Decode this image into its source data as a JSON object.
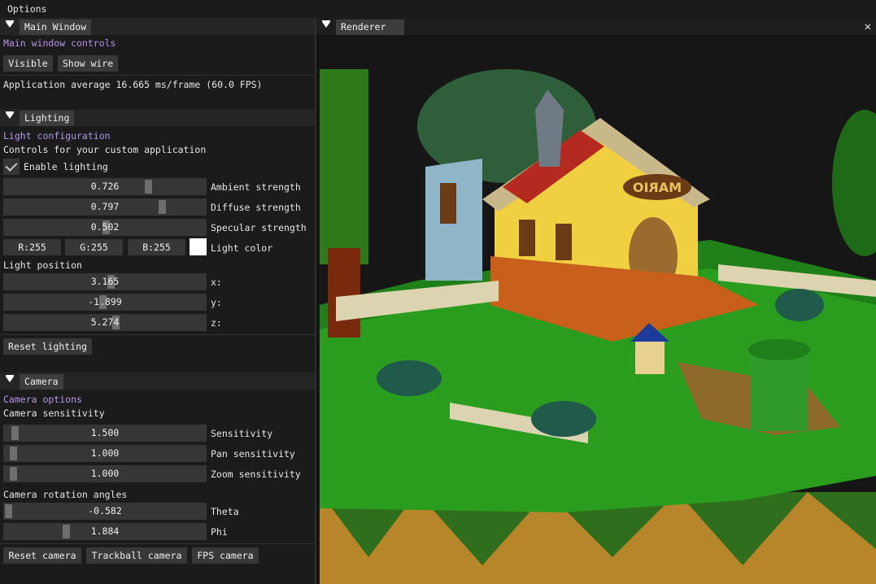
{
  "menubar": {
    "title": "Options"
  },
  "main_window": {
    "tab_label": "Main Window",
    "heading": "Main window controls",
    "visible_button": "Visible",
    "show_wire_button": "Show wire",
    "fps_text": "Application average 16.665 ms/frame (60.0 FPS)"
  },
  "lighting": {
    "tab_label": "Lighting",
    "heading": "Light configuration",
    "subheading": "Controls for your custom application",
    "enable_label": "Enable lighting",
    "enabled": true,
    "ambient": {
      "value": "0.726",
      "label": "Ambient strength",
      "fraction": 0.726
    },
    "diffuse": {
      "value": "0.797",
      "label": "Diffuse strength",
      "fraction": 0.797
    },
    "specular": {
      "value": "0.502",
      "label": "Specular strength",
      "fraction": 0.502
    },
    "color": {
      "r": "R:255",
      "g": "G:255",
      "b": "B:255",
      "label": "Light color",
      "swatch": "#ffffff"
    },
    "position_label": "Light position",
    "x": {
      "value": "3.165",
      "label": "x:"
    },
    "y": {
      "value": "-1.899",
      "label": "y:"
    },
    "z": {
      "value": "5.274",
      "label": "z:"
    },
    "reset_button": "Reset lighting"
  },
  "camera": {
    "tab_label": "Camera",
    "heading": "Camera options",
    "sensitivity_heading": "Camera sensitivity",
    "sensitivity": {
      "value": "1.500",
      "label": "Sensitivity"
    },
    "pan": {
      "value": "1.000",
      "label": "Pan sensitivity"
    },
    "zoom": {
      "value": "1.000",
      "label": "Zoom sensitivity"
    },
    "rotation_heading": "Camera rotation angles",
    "theta": {
      "value": "-0.582",
      "label": "Theta"
    },
    "phi": {
      "value": "1.884",
      "label": "Phi"
    },
    "reset_button": "Reset camera",
    "trackball_button": "Trackball camera",
    "fps_button": "FPS camera"
  },
  "renderer": {
    "tab_label": "Renderer",
    "close_icon": "close-icon",
    "house_sign": "MARIO"
  },
  "colors": {
    "accent_text": "#b694ea",
    "panel_bg": "#1b1b1b",
    "widget_bg": "#363636"
  }
}
